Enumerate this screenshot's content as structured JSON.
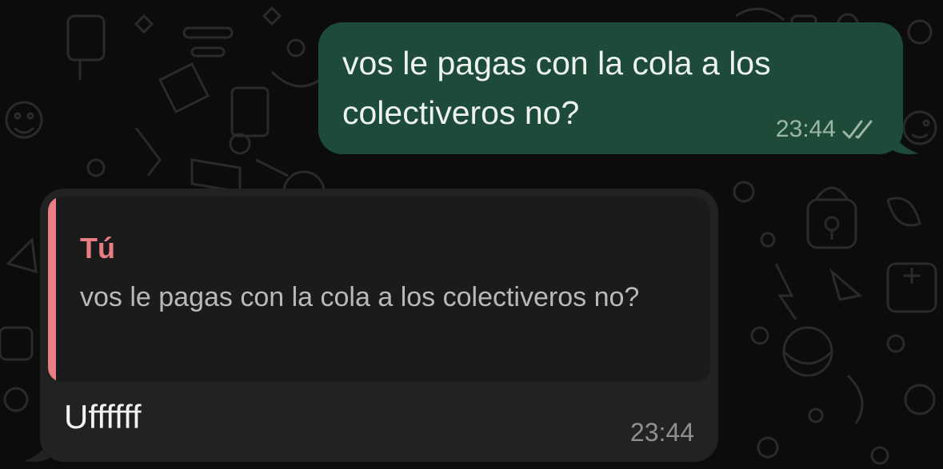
{
  "messages": {
    "outgoing": {
      "text": "vos le pagas con la cola a los colectiveros no?",
      "time": "23:44",
      "status_icon": "double-check-icon",
      "bubble_color": "#1e4a3a"
    },
    "incoming": {
      "reply_to": {
        "author": "Tú",
        "text": "vos le pagas con la cola a los colectiveros no?",
        "accent_color": "#e87d85"
      },
      "text": "Uffffff",
      "time": "23:44",
      "bubble_color": "#222222"
    }
  },
  "background": {
    "color": "#0c0c0c",
    "pattern": "doodle-wallpaper"
  }
}
